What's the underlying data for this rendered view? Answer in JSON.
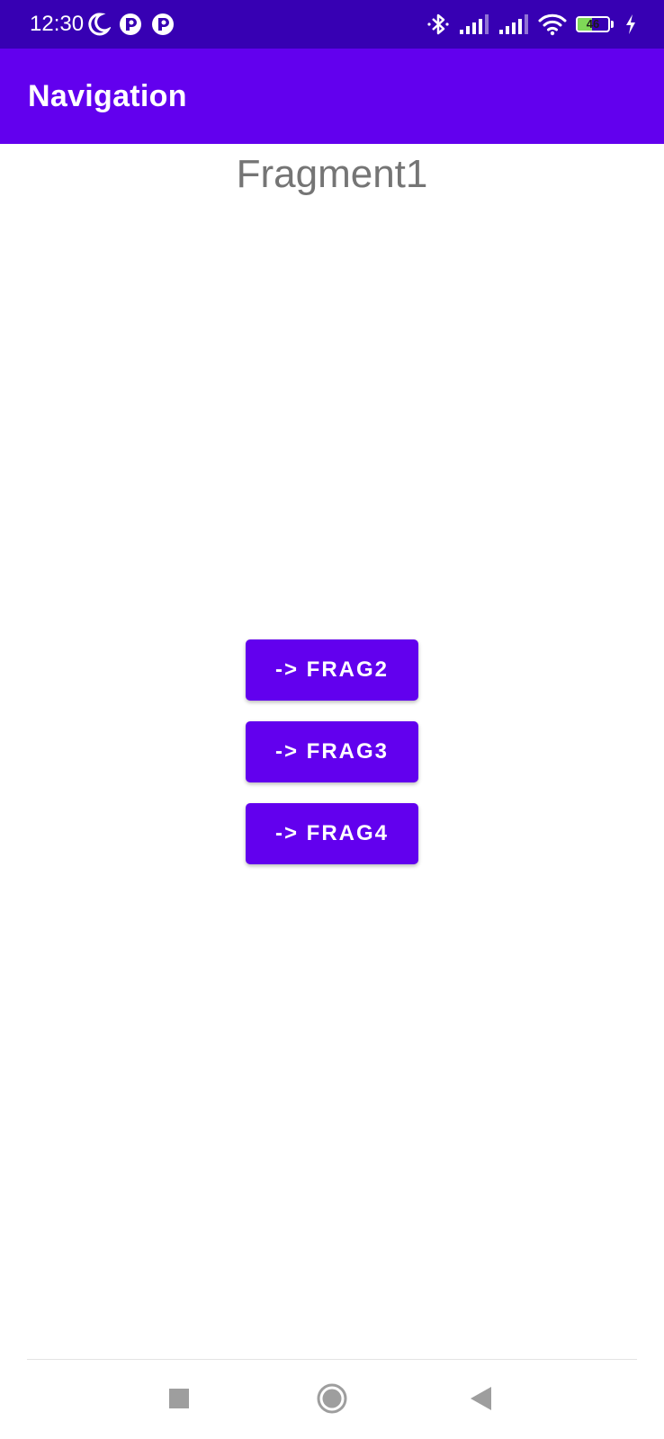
{
  "status_bar": {
    "time": "12:30",
    "battery_level": "46",
    "battery_fraction": 0.46,
    "icons": [
      "moon-icon",
      "notification-app-icon",
      "notification-app-icon",
      "bluetooth-icon",
      "signal-icon",
      "signal-icon",
      "wifi-icon",
      "battery-icon",
      "charging-icon"
    ],
    "colors": {
      "background": "#3700b3",
      "battery_fill": "#7ed957"
    }
  },
  "app_bar": {
    "title": "Navigation",
    "color": "#6200ee"
  },
  "content": {
    "fragment_label": "Fragment1",
    "buttons": [
      {
        "label": "-> FRAG2"
      },
      {
        "label": "-> FRAG3"
      },
      {
        "label": "-> FRAG4"
      }
    ],
    "button_color": "#6200ee"
  },
  "system_nav": {
    "keys": [
      "recents-icon",
      "home-icon",
      "back-icon"
    ]
  }
}
